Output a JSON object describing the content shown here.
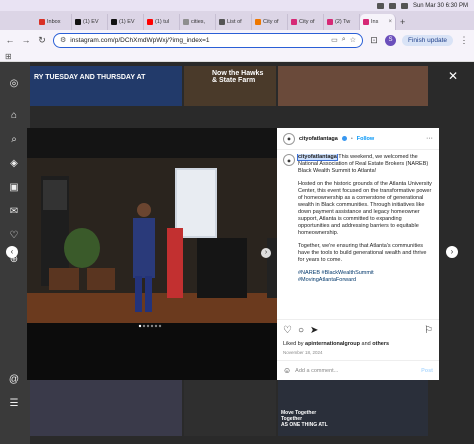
{
  "menubar": {
    "datetime": "Sun Mar 30  6:30 PM"
  },
  "tabs": [
    {
      "label": "Inbox",
      "color": "#d93025"
    },
    {
      "label": "(1) EV",
      "color": "#111111"
    },
    {
      "label": "(1) EV",
      "color": "#111111"
    },
    {
      "label": "(1) tul",
      "color": "#ff0000"
    },
    {
      "label": "cities,",
      "color": "#8e8e8e"
    },
    {
      "label": "List of",
      "color": "#555555"
    },
    {
      "label": "City of",
      "color": "#ee7700"
    },
    {
      "label": "City of",
      "color": "#d62976"
    },
    {
      "label": "(2) Tw",
      "color": "#d62976"
    },
    {
      "label": "Ins",
      "color": "#d62976"
    }
  ],
  "toolbar": {
    "url": "instagram.com/p/DChXmdWpWxj/?img_index=1",
    "profile_initial": "S",
    "finish_update": "Finish update"
  },
  "background_tiles": {
    "tile1": "RY TUESDAY AND THURSDAY AT",
    "tile2": "Now the Hawks\n& State Farm",
    "tile3": "Move Together\nTogether\nAS ONE THING ATL"
  },
  "post": {
    "username": "cityofatlantaga",
    "follow": "Follow",
    "caption_username": "cityofatlantaga",
    "caption_intro": " This weekend, we welcomed the National Association of Real Estate Brokers (NAREB) Black Wealth Summit to Atlanta!",
    "paragraph2": "Hosted on the historic grounds of the Atlanta University Center, this event focused on the transformative power of homeownership as a cornerstone of generational wealth in Black communities. Through initiatives like down payment assistance and legacy homeowner support, Atlanta is committed to expanding opportunities and addressing barriers to equitable homeownership.",
    "paragraph3": "Together, we're ensuring that Atlanta's communities have the tools to build generational wealth and thrive for years to come.",
    "hashtags": "#NAREB #BlackWealthSummit #MovingAtlantaForward",
    "likes_prefix": "Liked by ",
    "likes_user": "apinternationalgroup",
    "likes_and": " and ",
    "likes_others": "others",
    "date": "November 18, 2024",
    "comment_placeholder": "Add a comment...",
    "post_button": "Post"
  }
}
